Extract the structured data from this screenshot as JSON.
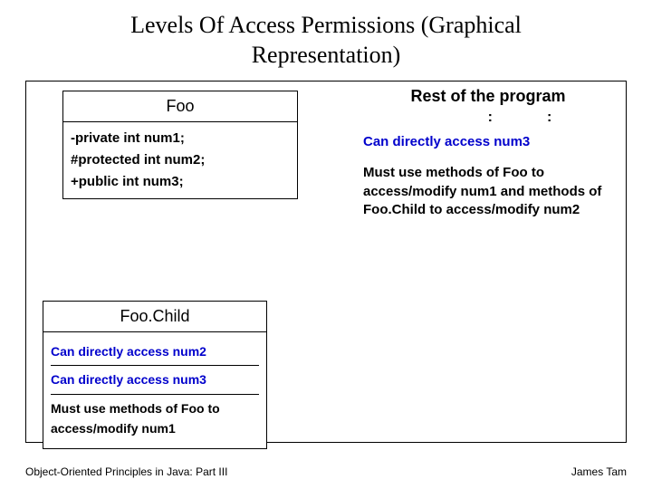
{
  "title": "Levels Of Access Permissions (Graphical Representation)",
  "foo": {
    "name": "Foo",
    "fields": {
      "f1": "-private int num1;",
      "f2": "#protected int num2;",
      "f3": "+public int num3;"
    }
  },
  "child": {
    "name": "Foo.Child",
    "lines": {
      "l1": "Can directly access num2",
      "l2": "Can directly access num3",
      "l3": "Must use methods of Foo to access/modify num1"
    }
  },
  "rest": {
    "heading": "Rest of the program",
    "dots": ":          :",
    "line1": "Can directly access num3",
    "line2": "Must use methods of Foo to access/modify num1 and methods of Foo.Child to access/modify num2"
  },
  "footer": {
    "left": "Object-Oriented Principles in Java: Part III",
    "right": "James Tam"
  }
}
